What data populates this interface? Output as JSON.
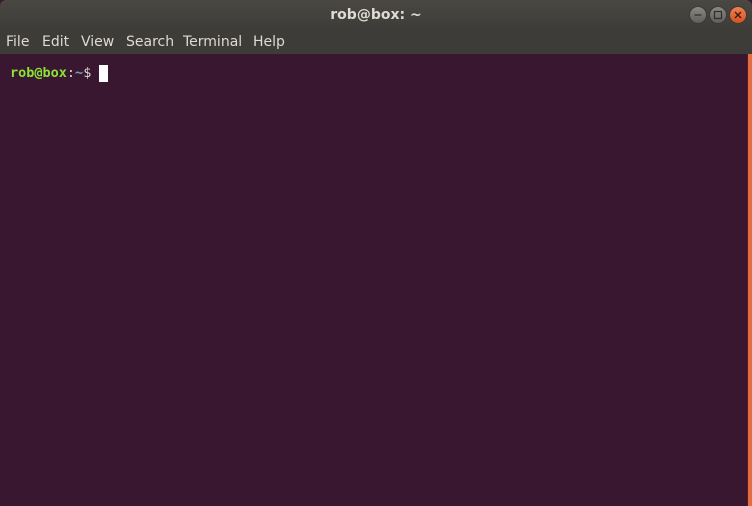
{
  "window": {
    "title": "rob@box: ~",
    "controls": {
      "minimize_icon": "minimize-icon",
      "maximize_icon": "maximize-icon",
      "close_icon": "close-icon"
    }
  },
  "menubar": {
    "items": [
      {
        "label": "File"
      },
      {
        "label": "Edit"
      },
      {
        "label": "View"
      },
      {
        "label": "Search"
      },
      {
        "label": "Terminal"
      },
      {
        "label": "Help"
      }
    ]
  },
  "terminal": {
    "prompt": {
      "user_host": "rob@box",
      "colon": ":",
      "path": "~",
      "symbol": "$"
    },
    "colors": {
      "background": "#3a1731",
      "user_host": "#8ae234",
      "path": "#729fcf",
      "scrollbar": "#e36d43"
    }
  }
}
